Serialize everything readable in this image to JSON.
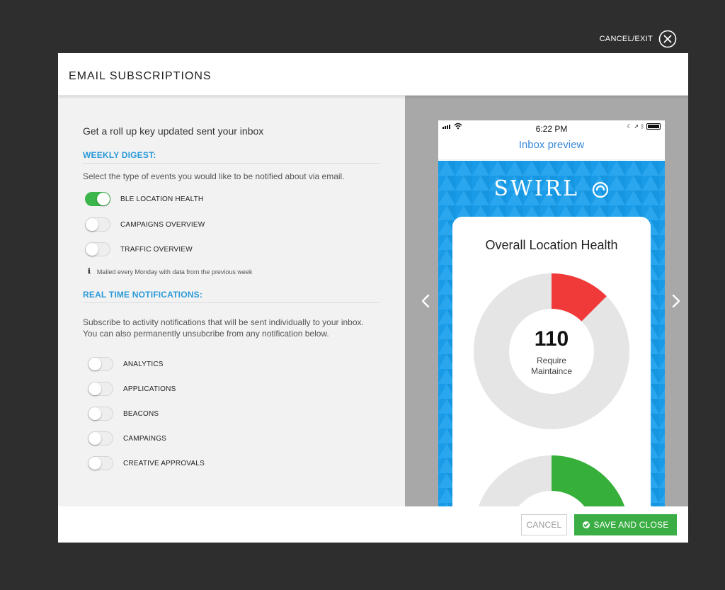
{
  "exit": {
    "label": "CANCEL/EXIT",
    "icon": "close-circle-icon"
  },
  "modal": {
    "title": "EMAIL SUBSCRIPTIONS"
  },
  "left": {
    "intro": "Get a roll up key updated sent your inbox",
    "weekly": {
      "title": "WEEKLY DIGEST:",
      "description": "Select the type of events you would like to be notified about via email.",
      "toggles": [
        {
          "label": "BLE LOCATION HEALTH",
          "on": true
        },
        {
          "label": "CAMPAIGNS OVERVIEW",
          "on": false
        },
        {
          "label": "TRAFFIC OVERVIEW",
          "on": false
        }
      ],
      "note": "Mailed every Monday with data from the previous week",
      "note_icon": "info-icon"
    },
    "realtime": {
      "title": "REAL TIME NOTIFICATIONS:",
      "description_line1": "Subscribe to activity notifications that will be sent individually to your inbox.",
      "description_line2": "You can also permanently unsubcribe from any notification below.",
      "toggles": [
        {
          "label": "ANALYTICS",
          "on": false
        },
        {
          "label": "APPLICATIONS",
          "on": false
        },
        {
          "label": "BEACONS",
          "on": false
        },
        {
          "label": "CAMPAINGS",
          "on": false
        },
        {
          "label": "CREATIVE APPROVALS",
          "on": false
        }
      ]
    }
  },
  "preview": {
    "time": "6:22 PM",
    "title": "Inbox preview",
    "brand": "SWIRL",
    "card_title": "Overall Location Health",
    "count": "110",
    "count_label_line1": "Require",
    "count_label_line2": "Maintaince",
    "donut_fraction_red": 0.125,
    "donut2_fraction_green": 0.3,
    "colors": {
      "red": "#f03a3a",
      "green": "#36b03a",
      "track": "#e5e5e5",
      "blue": "#1a9be8"
    },
    "icons": {
      "prev": "chevron-left-icon",
      "next": "chevron-right-icon"
    }
  },
  "footer": {
    "cancel": "CANCEL",
    "save": "SAVE AND CLOSE"
  }
}
